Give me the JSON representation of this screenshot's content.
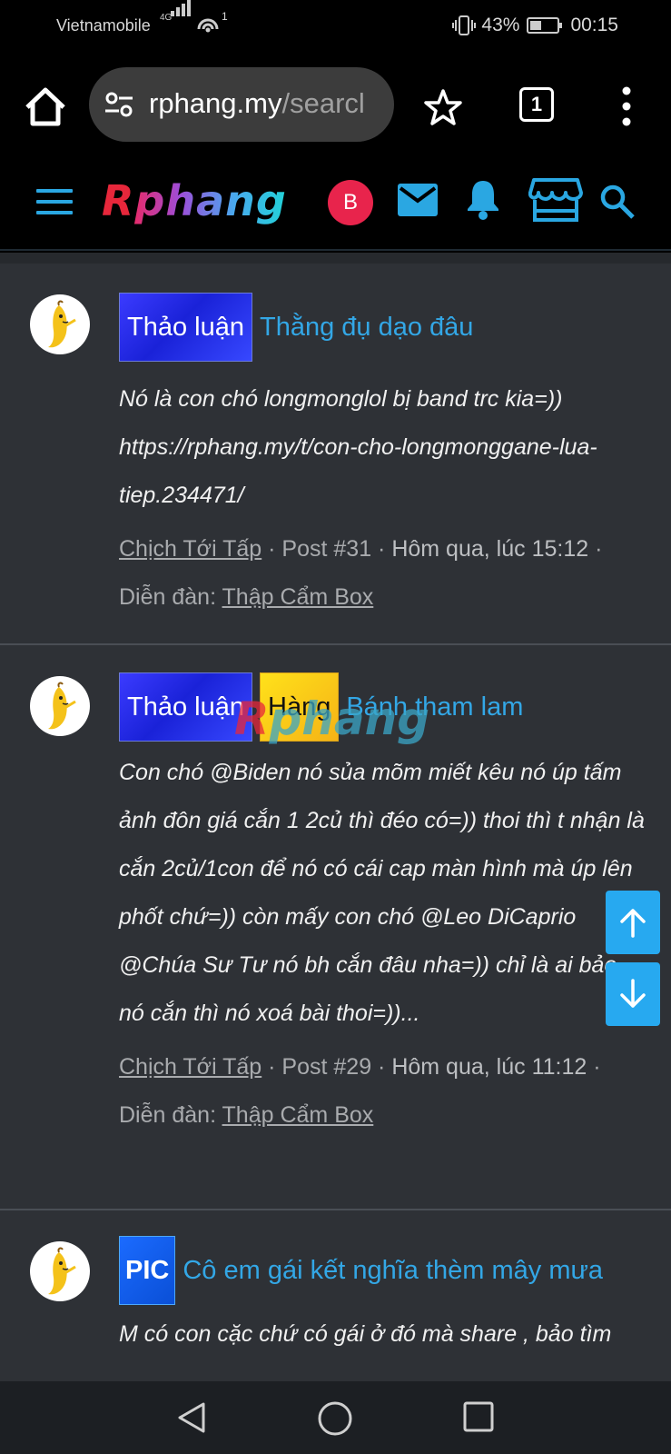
{
  "status_bar": {
    "carrier": "Vietnamobile",
    "network_type": "4G",
    "wifi_count": "1",
    "battery_percent": "43%",
    "battery_level": 0.43,
    "time": "00:15"
  },
  "browser": {
    "url_host": "rphang.my",
    "url_rest": "/searcl",
    "tabs_count": "1",
    "icons": [
      "home-icon",
      "site-settings-icon",
      "star-icon",
      "tabs-icon",
      "overflow-menu-icon"
    ]
  },
  "site_header": {
    "logo_first": "R",
    "logo_rest": "phang",
    "user_initial": "B",
    "icons": [
      "hamburger-icon",
      "mail-icon",
      "bell-icon",
      "store-icon",
      "search-icon"
    ],
    "accent_color": "#2aa7e2"
  },
  "posts": [
    {
      "labels": [
        {
          "text": "Thảo luận",
          "kind": "discussion"
        }
      ],
      "title": "Thằng đụ dạo đâu",
      "snippet": "Nó là con chó longmonglol bị band trc kia=)) https://rphang.my/t/con-cho-longmonggane-lua-tiep.234471/",
      "author": "Chịch Tới Tấp",
      "post_no": "Post #31",
      "date": "Hôm qua, lúc 15:12",
      "forum_label": "Diễn đàn:",
      "forum": "Thập Cẩm Box"
    },
    {
      "labels": [
        {
          "text": "Thảo luận",
          "kind": "discussion"
        },
        {
          "text": "Hàng",
          "kind": "goods"
        }
      ],
      "title": "Bánh tham lam",
      "snippet": "Con chó @Biden nó sủa mõm miết kêu nó úp tấm ảnh đôn giá cắn 1 2củ thì đéo có=)) thoi thì t nhận là cắn 2củ/1con để nó có cái cap màn hình mà úp lên phốt chứ=)) còn mấy con chó @Leo DiCaprio @Chúa Sư Tư nó bh cắn đâu nha=)) chỉ là ai bảo nó cắn thì nó xoá bài thoi=))...",
      "author": "Chịch Tới Tấp",
      "post_no": "Post #29",
      "date": "Hôm qua, lúc 11:12",
      "forum_label": "Diễn đàn:",
      "forum": "Thập Cẩm Box"
    },
    {
      "labels": [
        {
          "text": "PIC",
          "kind": "pic"
        }
      ],
      "title": "Cô em gái kết nghĩa thèm mây mưa",
      "snippet": "M có con cặc chứ có gái ở đó mà share , bảo tìm"
    }
  ],
  "watermark": {
    "first": "R",
    "rest": "phang"
  },
  "scroll_buttons": [
    "arrow-up-icon",
    "arrow-down-icon"
  ],
  "nav_bar": [
    "back-icon",
    "home-circle-icon",
    "recents-icon"
  ]
}
